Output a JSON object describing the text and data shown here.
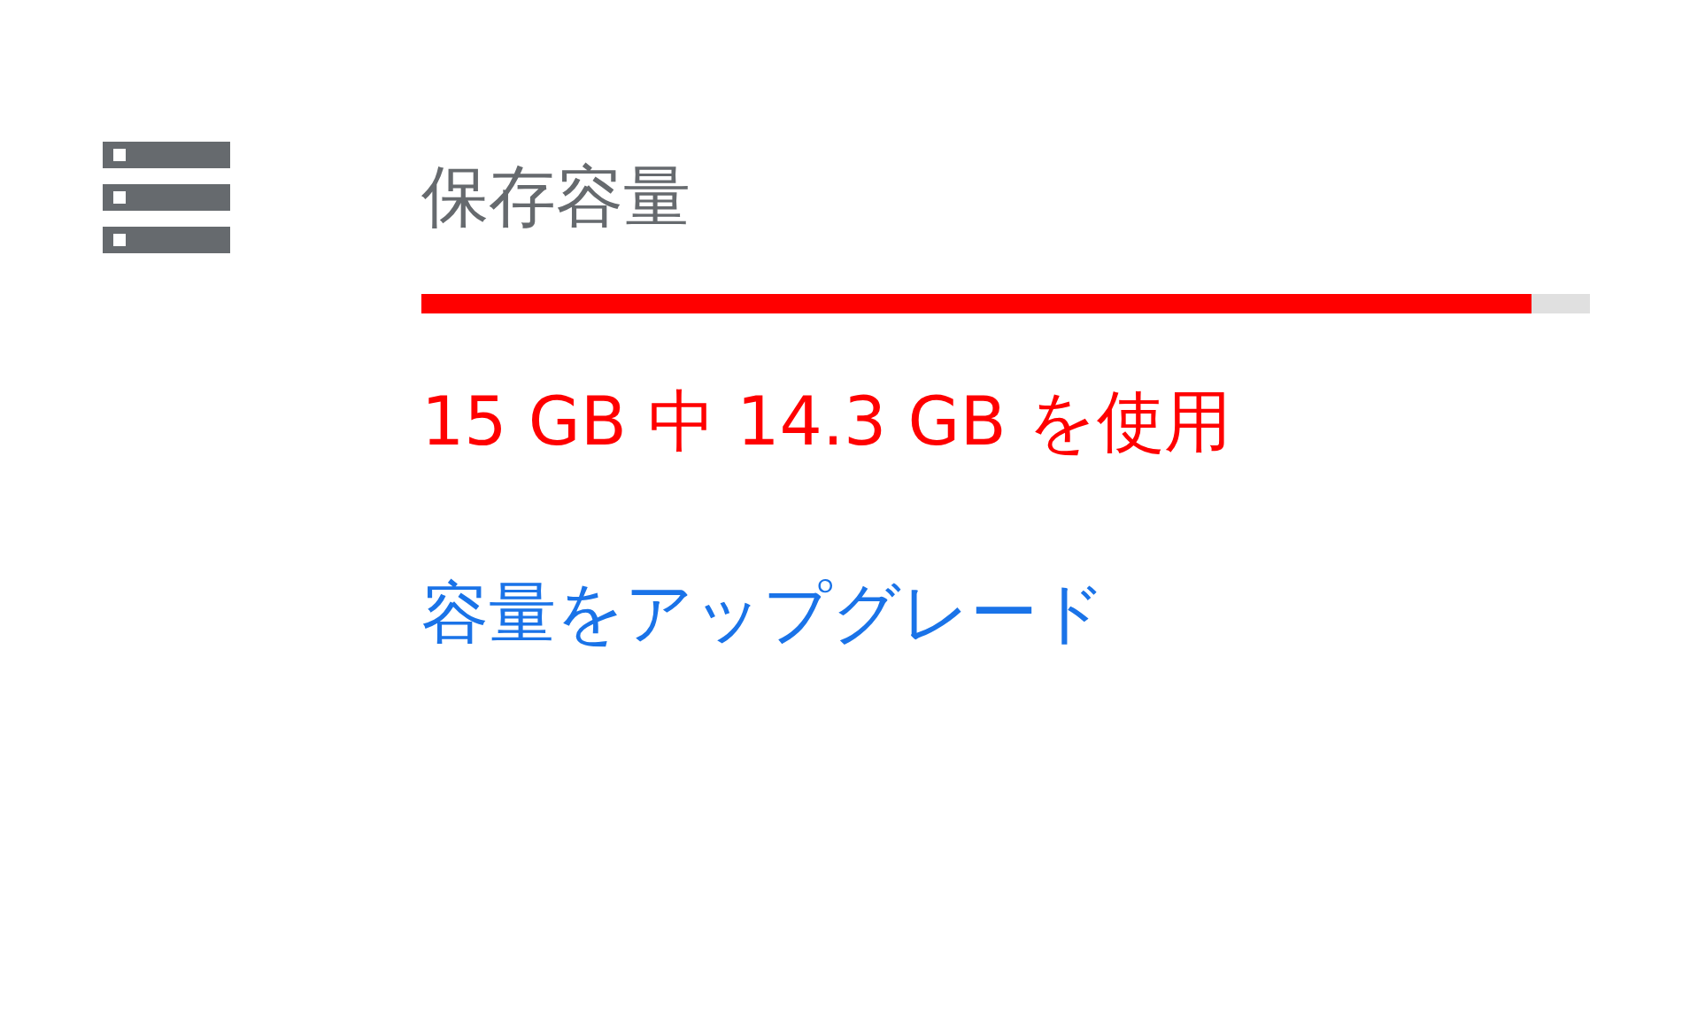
{
  "storage": {
    "title": "保存容量",
    "level": 0.95,
    "usage": "15 GB 中 14.3 GB を使用",
    "upgrade_link": "容量をアップグレード"
  }
}
